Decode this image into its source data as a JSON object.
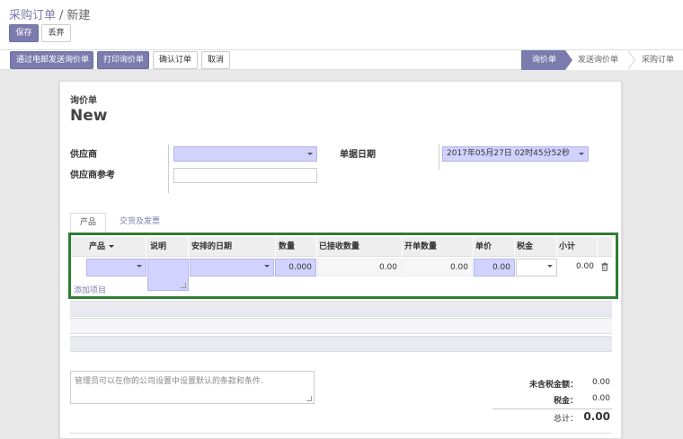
{
  "breadcrumb": {
    "parent": "采购订单",
    "separator": "/",
    "current": "新建"
  },
  "toolbar": {
    "save_label": "保存",
    "discard_label": "丢弃"
  },
  "actions": {
    "send_email": "通过电邮发送询价单",
    "print_rfq": "打印询价单",
    "confirm_order": "确认订单",
    "cancel": "取消"
  },
  "stages": [
    {
      "label": "询价单",
      "active": true
    },
    {
      "label": "发送询价单",
      "active": false
    },
    {
      "label": "采购订单",
      "active": false
    }
  ],
  "form": {
    "doc_type": "询价单",
    "title": "New",
    "vendor_label": "供应商",
    "vendor_value": "",
    "vendor_ref_label": "供应商参考",
    "vendor_ref_value": "",
    "order_date_label": "单据日期",
    "order_date_value": "2017年05月27日 02时45分52秒"
  },
  "tabs": [
    {
      "label": "产品",
      "active": true
    },
    {
      "label": "交货及发票",
      "active": false
    }
  ],
  "order_lines": {
    "columns": [
      "产品",
      "说明",
      "安排的日期",
      "数量",
      "已接收数量",
      "开单数量",
      "单价",
      "税金",
      "小计"
    ],
    "row": {
      "product": "",
      "description": "",
      "scheduled_date": "",
      "quantity": "0.000",
      "qty_received": "0.00",
      "qty_invoiced": "0.00",
      "unit_price": "0.00",
      "taxes": "",
      "subtotal": "0.00"
    },
    "add_line": "添加项目"
  },
  "notes_placeholder": "管理员可以在你的公司设置中设置默认的条款和条件.",
  "totals": {
    "untaxed_label": "未含税金额：",
    "untaxed_value": "0.00",
    "tax_label": "税金：",
    "tax_value": "0.00",
    "total_label": "总计：",
    "total_value": "0.00"
  },
  "colors": {
    "primary": "#7c7bad",
    "required_field": "#d2d2ff",
    "highlight": "#2e7d32"
  },
  "icons": {
    "delete_row": "trash-icon",
    "dropdown": "chevron-down-icon"
  }
}
